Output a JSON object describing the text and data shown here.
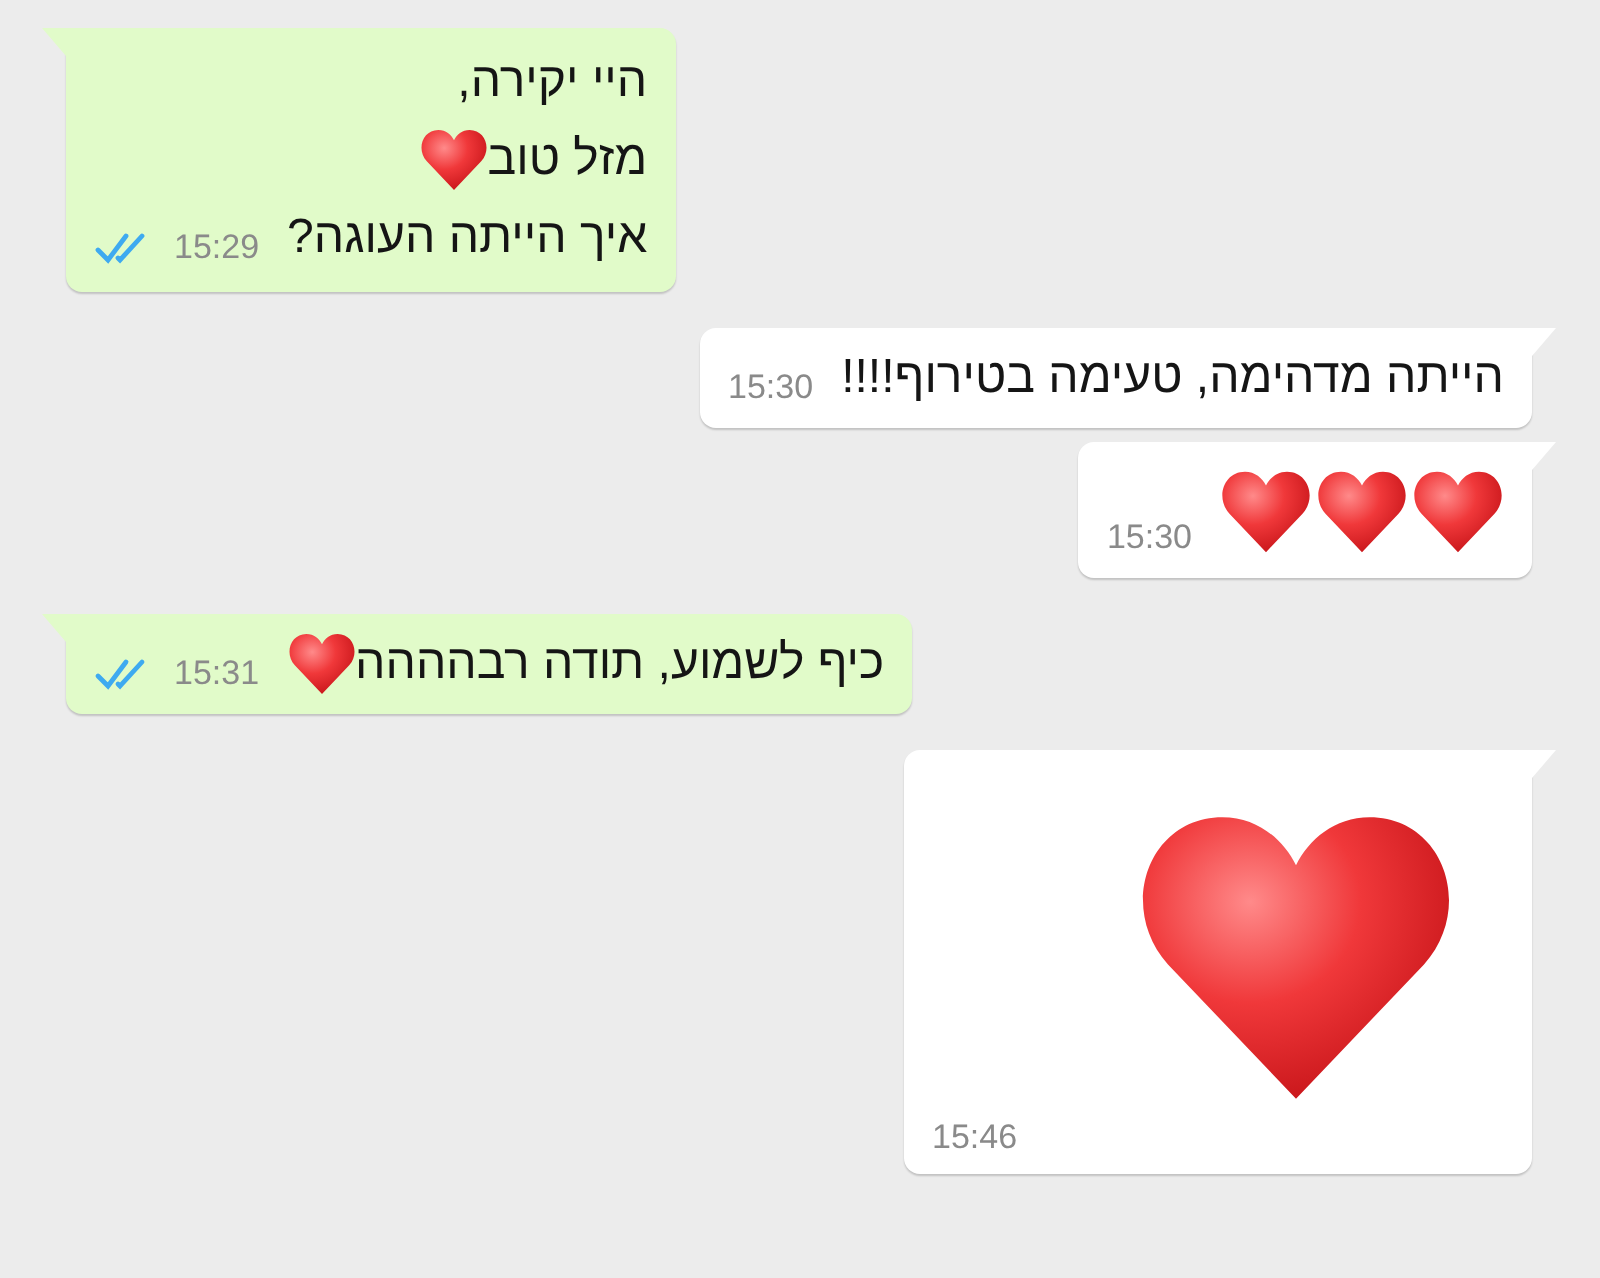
{
  "messages": [
    {
      "kind": "text",
      "outgoing": true,
      "lines": [
        {
          "text": "היי יקירה,",
          "heart": false
        },
        {
          "text": "מזל טוב",
          "heart": true
        },
        {
          "text": "איך הייתה העוגה?",
          "heart": false
        }
      ],
      "time": "15:29",
      "read": true
    },
    {
      "kind": "text",
      "outgoing": false,
      "lines": [
        {
          "text": "הייתה מדהימה, טעימה בטירוף!!!!",
          "heart": false
        }
      ],
      "time": "15:30"
    },
    {
      "kind": "emoji",
      "outgoing": false,
      "emojis": [
        {
          "kind": "heart"
        },
        {
          "kind": "heart"
        },
        {
          "kind": "heart"
        }
      ],
      "time": "15:30"
    },
    {
      "kind": "text",
      "outgoing": true,
      "lines": [
        {
          "text": "כיף לשמוע, תודה רבהההה",
          "heart": true
        }
      ],
      "time": "15:31",
      "read": true
    },
    {
      "kind": "sticker",
      "outgoing": false,
      "time": "15:46"
    }
  ]
}
